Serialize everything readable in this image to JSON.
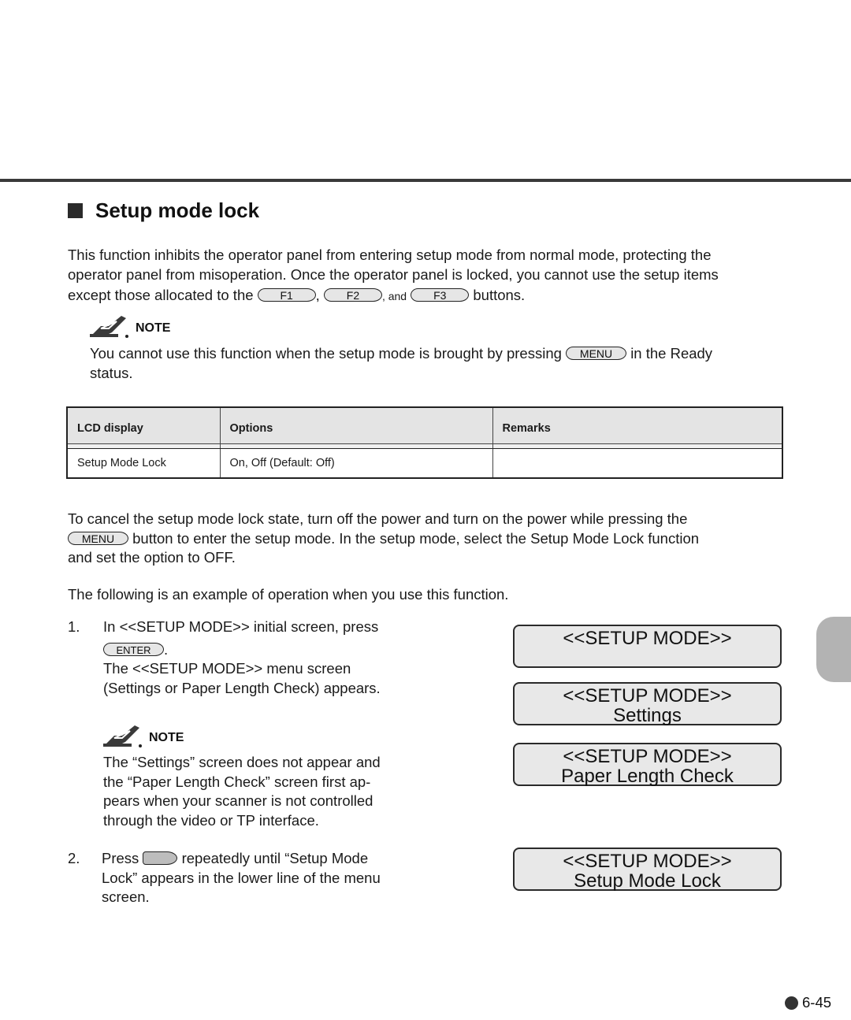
{
  "section": {
    "title": "Setup mode lock"
  },
  "intro": {
    "line1": "This function inhibits the operator panel from entering setup mode from normal mode, protecting the",
    "line2": "operator panel from misoperation.  Once the operator panel is locked, you cannot use the setup items",
    "line3_prefix": "except those allocated to the",
    "comma": ",",
    "and": ", and",
    "line3_suffix": "buttons.",
    "buttons": [
      "F1",
      "F2",
      "F3"
    ]
  },
  "note1": {
    "label": "NOTE",
    "text_before": "You cannot use this function when the setup mode is brought by pressing",
    "button": "MENU",
    "text_after": "in the Ready",
    "line2": "status."
  },
  "table": {
    "headers": [
      "LCD display",
      "Options",
      "Remarks"
    ],
    "rows": [
      [
        "Setup Mode Lock",
        "On, Off (Default: Off)",
        ""
      ]
    ]
  },
  "cancel": {
    "line1": "To cancel the setup mode lock state, turn off the power and turn on the power while pressing the",
    "button": "MENU",
    "line2_after": "button to enter the setup mode.  In the setup mode, select the Setup Mode Lock function",
    "line3": "and set the option to OFF."
  },
  "example_intro": "The following is an example of operation when you use this function.",
  "steps": [
    {
      "number": "1.",
      "line1": "In <<SETUP MODE>> initial screen, press",
      "button": "ENTER",
      "button_suffix": ".",
      "line3": "The <<SETUP MODE>> menu screen",
      "line4": "(Settings or Paper Length Check) appears."
    },
    {
      "number": "2.",
      "prefix": "Press",
      "button_icon": "right-arrow-key-icon",
      "line1_after": "repeatedly until “Setup Mode",
      "line2": "Lock” appears in the lower line of the menu",
      "line3": "screen."
    }
  ],
  "note2": {
    "label": "NOTE",
    "lines": [
      "The “Settings” screen does not appear and",
      "the “Paper Length Check” screen first ap-",
      "pears when your scanner is not controlled",
      "through the video or TP interface."
    ]
  },
  "lcd_screens": [
    {
      "line1": "<<SETUP MODE>>",
      "line2": ""
    },
    {
      "line1": "<<SETUP MODE>>",
      "line2": "Settings"
    },
    {
      "line1": "<<SETUP MODE>>",
      "line2": "Paper Length Check"
    },
    {
      "line1": "<<SETUP MODE>>",
      "line2": "Setup Mode Lock"
    }
  ],
  "footer": {
    "page_number": "6-45"
  },
  "colors": {
    "lcd_background": "#e8e8e8",
    "table_header_background": "#e4e4e4",
    "side_tab": "#b3b3b3",
    "rule": "#3a3a3a"
  }
}
